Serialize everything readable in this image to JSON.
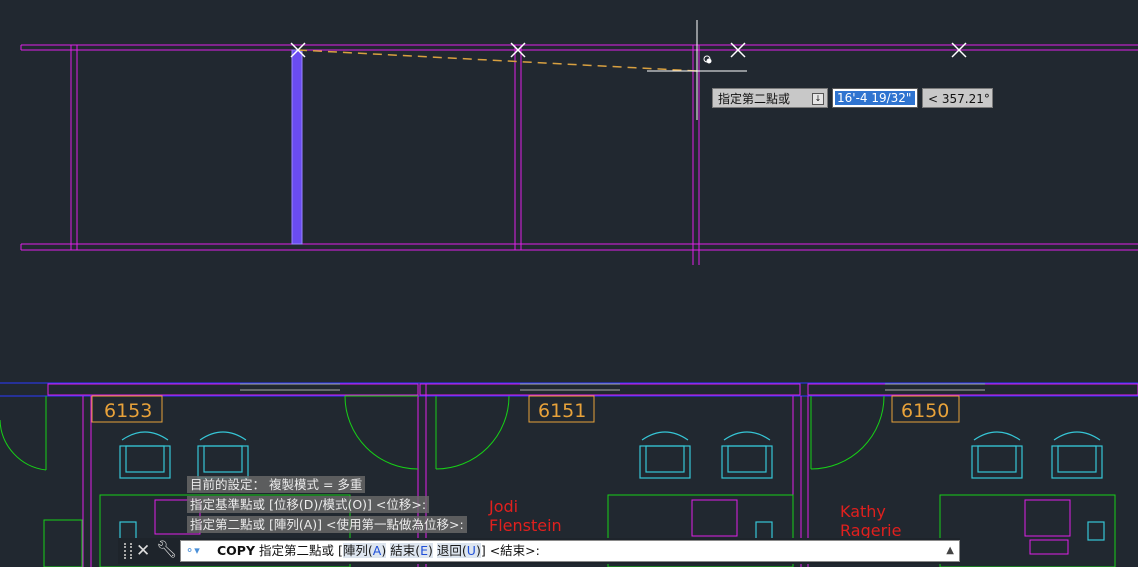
{
  "tooltip": {
    "prompt": "指定第二點或",
    "distance": "16'-4 19/32\"",
    "angle": "< 357.21°"
  },
  "rooms": [
    {
      "number": "6153"
    },
    {
      "number": "6151"
    },
    {
      "number": "6150"
    }
  ],
  "occupants": [
    {
      "first": "Jodi",
      "last": "Flenstein"
    },
    {
      "first": "Kathy",
      "last": "Ragerie"
    }
  ],
  "command_history": [
    "目前的設定：  複製模式 = 多重",
    "指定基準點或 [位移(D)/模式(O)] <位移>:",
    "指定第二點或 [陣列(A)] <使用第一點做為位移>:"
  ],
  "command_line": {
    "command": "COPY",
    "prompt": "指定第二點或 [",
    "options": [
      {
        "label": "陣列",
        "key": "A"
      },
      {
        "label": "結束",
        "key": "E"
      },
      {
        "label": "退回",
        "key": "U"
      }
    ],
    "suffix": "] <結束>:"
  },
  "colors": {
    "background": "#212830",
    "wall": "#e020e8",
    "door": "#17d017",
    "furniture": "#36c6d6",
    "room_tag": "#e8a23a",
    "occupant_text": "#e0201e",
    "rubber_band": "#d8a040",
    "selected_line": "#7a5aff",
    "crosshair": "#ffffff"
  },
  "icons": [
    "close-icon",
    "wrench-icon",
    "recent-commands-icon",
    "grip-icon",
    "scroll-up-icon",
    "menu-icon",
    "cursor-crosshair"
  ]
}
